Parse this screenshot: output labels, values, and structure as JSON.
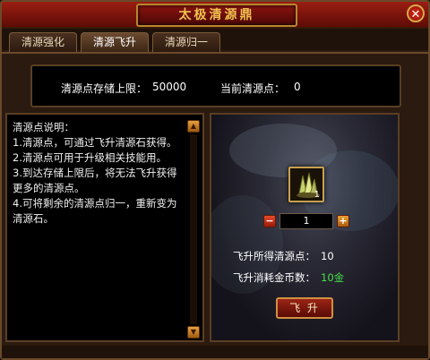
{
  "window": {
    "title": "太极清源鼎",
    "close_label": "✕"
  },
  "tabs": [
    {
      "label": "清源强化",
      "active": false
    },
    {
      "label": "清源飞升",
      "active": true
    },
    {
      "label": "清源归一",
      "active": false
    }
  ],
  "infobar": {
    "storage_label": "清源点存储上限：",
    "storage_value": "50000",
    "current_label": "当前清源点：",
    "current_value": "0"
  },
  "description": {
    "title": "清源点说明：",
    "lines": [
      "1.清源点，可通过飞升清源石获得。",
      "2.清源点可用于升级相关技能用。",
      "3.到达存储上限后，将无法飞升获得更多的清源点。",
      "4.可将剩余的清源点归一，重新变为清源石。"
    ]
  },
  "item": {
    "icon": "crystal-stone-icon",
    "count": "1"
  },
  "quantity": {
    "minus": "−",
    "value": "1",
    "plus": "+"
  },
  "stats": {
    "gain_label": "飞升所得清源点：",
    "gain_value": "10",
    "cost_label": "飞升消耗金币数：",
    "cost_value": "10金"
  },
  "fly_button_label": "飞 升",
  "colors": {
    "title_red": "#9a1e12",
    "gold_border": "#c8a050",
    "cost_green": "#48e048"
  }
}
